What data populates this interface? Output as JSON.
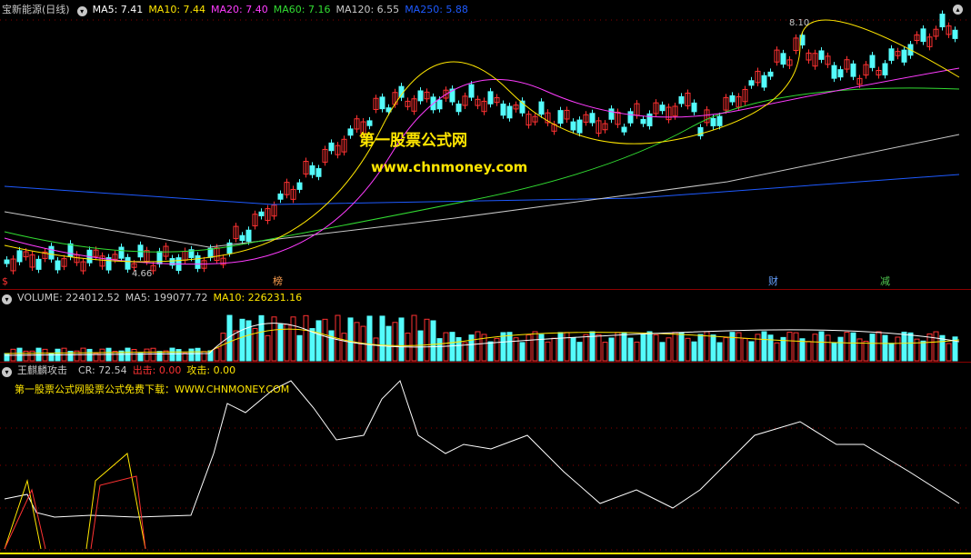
{
  "main": {
    "title": "宝新能源(日线)",
    "ma": [
      {
        "label": "MA5: 7.41",
        "color": "#ffffff"
      },
      {
        "label": "MA10: 7.44",
        "color": "#ffe600"
      },
      {
        "label": "MA20: 7.40",
        "color": "#ff3cff"
      },
      {
        "label": "MA60: 7.16",
        "color": "#32dc32"
      },
      {
        "label": "MA120: 6.55",
        "color": "#c8c8c8"
      },
      {
        "label": "MA250: 5.88",
        "color": "#1e5aff"
      }
    ],
    "high_label": "8.10",
    "low_label": "4.66",
    "watermark_cn": "第一股票公式网",
    "watermark_url": "www.chnmoney.com",
    "tags": [
      {
        "text": "$",
        "color": "#ff3232"
      },
      {
        "text": "榜",
        "color": "#ffa050"
      },
      {
        "text": "财",
        "color": "#64a0ff"
      },
      {
        "text": "减",
        "color": "#50c850"
      }
    ]
  },
  "volume": {
    "name": "VOLUME: 224012.52",
    "ma5": "MA5: 199077.72",
    "ma10": "MA10: 226231.16"
  },
  "indicator": {
    "name": "王麒麟攻击",
    "cr": "CR: 72.54",
    "out_label": "出击: 0.00",
    "attack_label": "攻击: 0.00",
    "note": "第一股票公式网股票公式免费下载：WWW.CHNMONEY.COM"
  },
  "colors": {
    "up": "#ff3232",
    "down": "#54fcfc",
    "bg": "#000000"
  }
}
